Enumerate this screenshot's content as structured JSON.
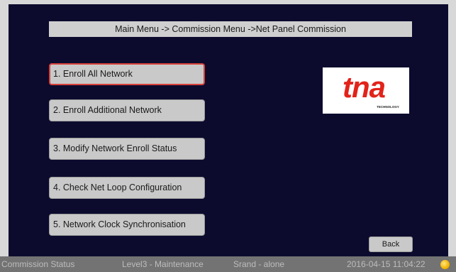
{
  "header": {
    "breadcrumb": "Main Menu -> Commission Menu ->Net Panel Commission"
  },
  "menu": {
    "items": [
      {
        "label": "1. Enroll All Network"
      },
      {
        "label": "2. Enroll Additional Network"
      },
      {
        "label": "3. Modify Network Enroll Status"
      },
      {
        "label": "4. Check Net Loop Configuration"
      },
      {
        "label": "5. Network Clock Synchronisation"
      }
    ]
  },
  "logo": {
    "brand": "tna",
    "tagline": "TECHNOLOGY",
    "accent_color": "#e2231a"
  },
  "actions": {
    "back_label": "Back"
  },
  "status": {
    "mode": "Commission Status",
    "access_level": "Level3 - Maintenance",
    "panel_mode": "Srand - alone",
    "datetime": "2016-04-15 11:04:22",
    "indicator_icon": "status-lamp-icon"
  },
  "colors": {
    "screen_background": "#0c0b2e",
    "selected_border": "#d8413a",
    "button_background": "#c9c9c9",
    "status_bar": "#737373"
  }
}
